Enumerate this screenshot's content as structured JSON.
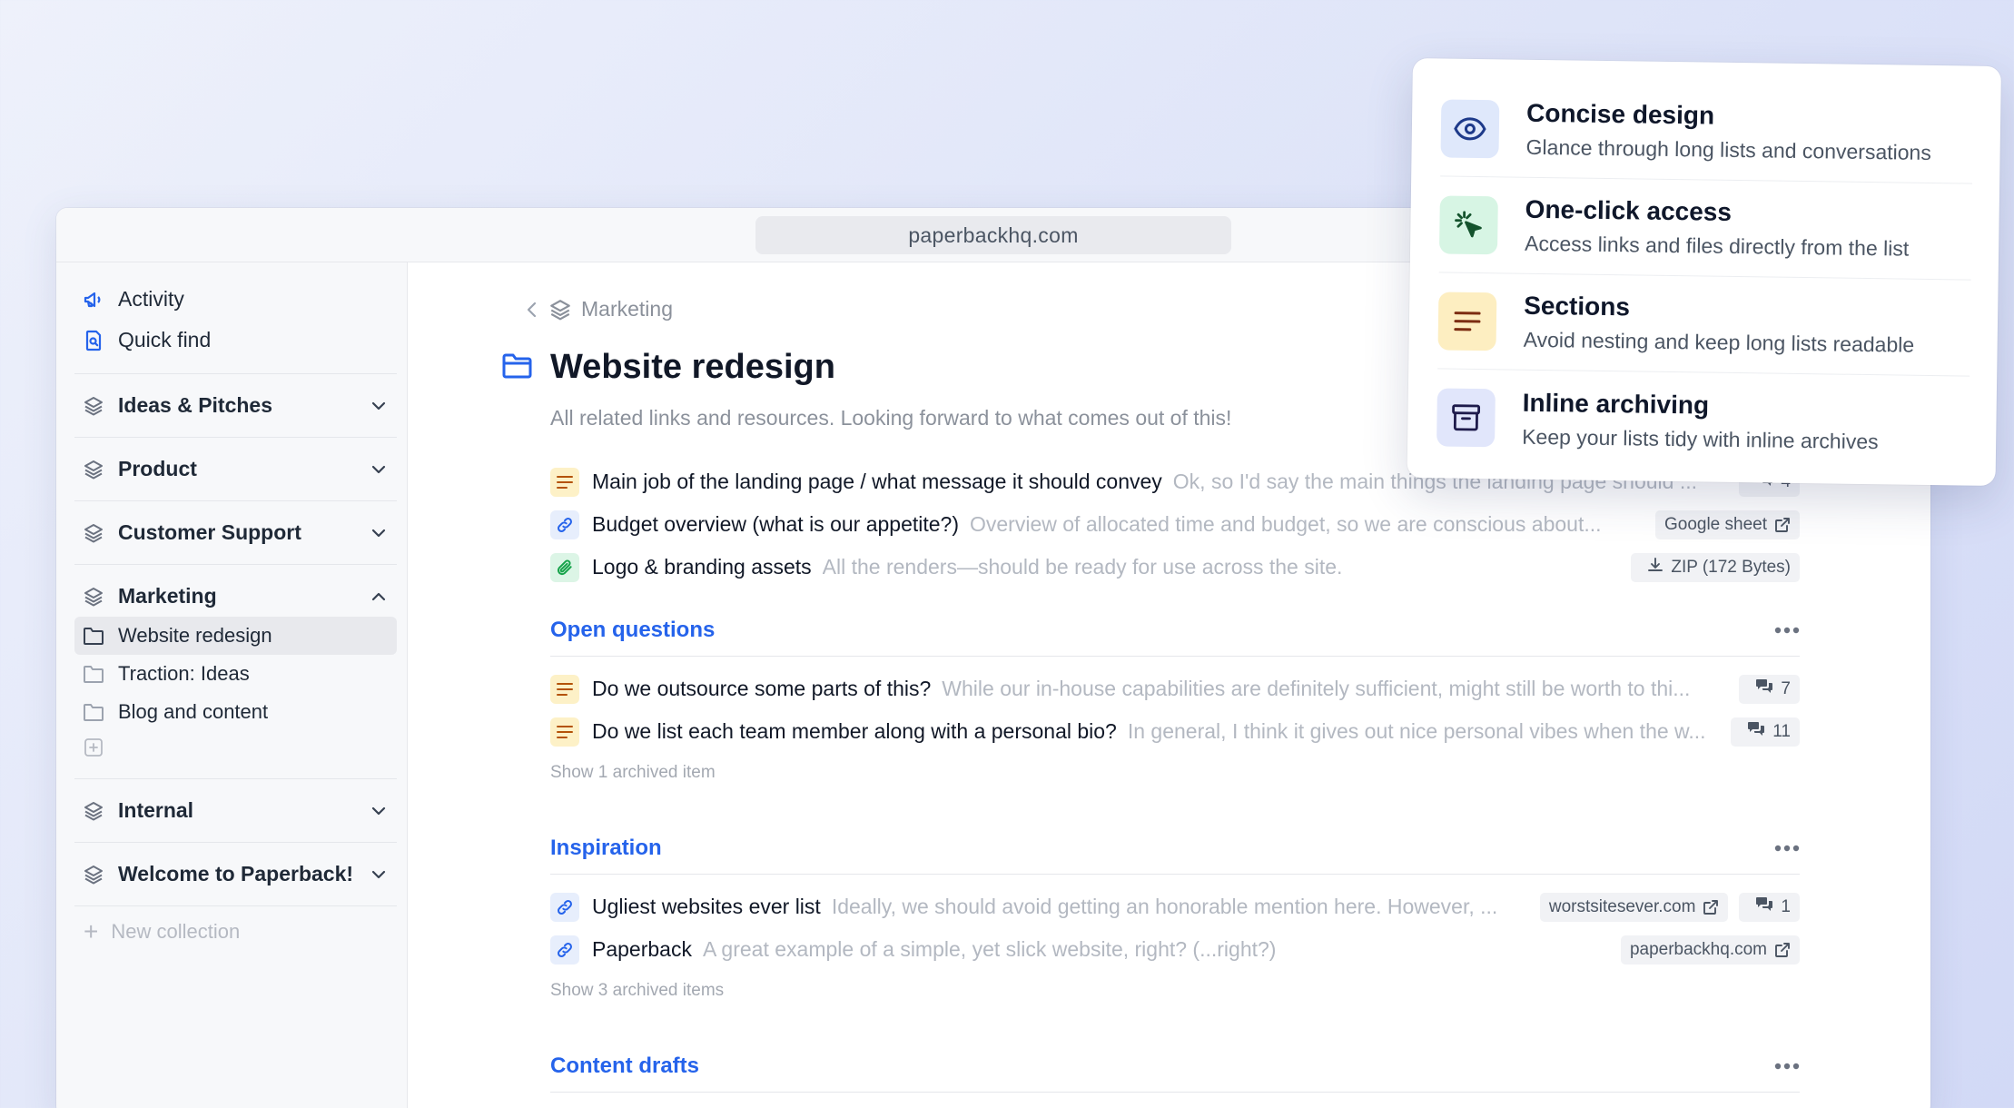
{
  "browser": {
    "url": "paperbackhq.com"
  },
  "sidebar": {
    "top_items": [
      {
        "label": "Activity",
        "icon": "megaphone-icon"
      },
      {
        "label": "Quick find",
        "icon": "search-file-icon"
      }
    ],
    "collections": [
      {
        "label": "Ideas & Pitches",
        "expanded": false
      },
      {
        "label": "Product",
        "expanded": false
      },
      {
        "label": "Customer Support",
        "expanded": false
      },
      {
        "label": "Marketing",
        "expanded": true,
        "items": [
          {
            "label": "Website redesign",
            "active": true
          },
          {
            "label": "Traction: Ideas",
            "active": false
          },
          {
            "label": "Blog and content",
            "active": false
          }
        ]
      },
      {
        "label": "Internal",
        "expanded": false
      },
      {
        "label": "Welcome to Paperback!",
        "expanded": false
      }
    ],
    "new_collection_label": "New collection"
  },
  "main": {
    "breadcrumb": "Marketing",
    "title": "Website redesign",
    "description": "All related links and resources. Looking forward to what comes out of this!",
    "items": [
      {
        "type": "note",
        "title": "Main job of the landing page / what message it should convey",
        "snippet": "Ok, so I'd say the main things the landing page should ...",
        "comments": "4"
      },
      {
        "type": "link",
        "title": "Budget overview (what is our appetite?)",
        "snippet": "Overview of allocated time and budget, so we are conscious about...",
        "chip": "Google sheet"
      },
      {
        "type": "file",
        "title": "Logo & branding assets",
        "snippet": "All the renders—should be ready for use across the site.",
        "chip": "ZIP (172 Bytes)"
      }
    ],
    "sections": [
      {
        "title": "Open questions",
        "items": [
          {
            "type": "note",
            "title": "Do we outsource some parts of this?",
            "snippet": "While our in-house capabilities are definitely sufficient, might still be worth to thi...",
            "comments": "7"
          },
          {
            "type": "note",
            "title": "Do we list each team member along with a personal bio?",
            "snippet": "In general, I think it gives out nice personal vibes when the w...",
            "comments": "11"
          }
        ],
        "archived": "Show 1 archived item"
      },
      {
        "title": "Inspiration",
        "items": [
          {
            "type": "link",
            "title": "Ugliest websites ever list",
            "snippet": "Ideally, we should avoid getting an honorable mention here. However, ...",
            "chip": "worstsitesever.com",
            "comments": "1"
          },
          {
            "type": "link",
            "title": "Paperback",
            "snippet": "A great example of a simple, yet slick website, right? (...right?)",
            "chip": "paperbackhq.com"
          }
        ],
        "archived": "Show 3 archived items"
      },
      {
        "title": "Content drafts"
      }
    ]
  },
  "features": [
    {
      "title": "Concise design",
      "desc": "Glance through long lists and conversations",
      "icon": "eye-icon"
    },
    {
      "title": "One-click access",
      "desc": "Access links and files directly from the list",
      "icon": "cursor-click-icon"
    },
    {
      "title": "Sections",
      "desc": "Avoid nesting and keep long lists readable",
      "icon": "lines-icon"
    },
    {
      "title": "Inline archiving",
      "desc": "Keep your lists tidy with inline archives",
      "icon": "archive-box-icon"
    }
  ],
  "colors": {
    "accent": "#2563eb",
    "note_bg": "#fdf1c7",
    "link_bg": "#e7eefc",
    "file_bg": "#dcf5e6"
  }
}
